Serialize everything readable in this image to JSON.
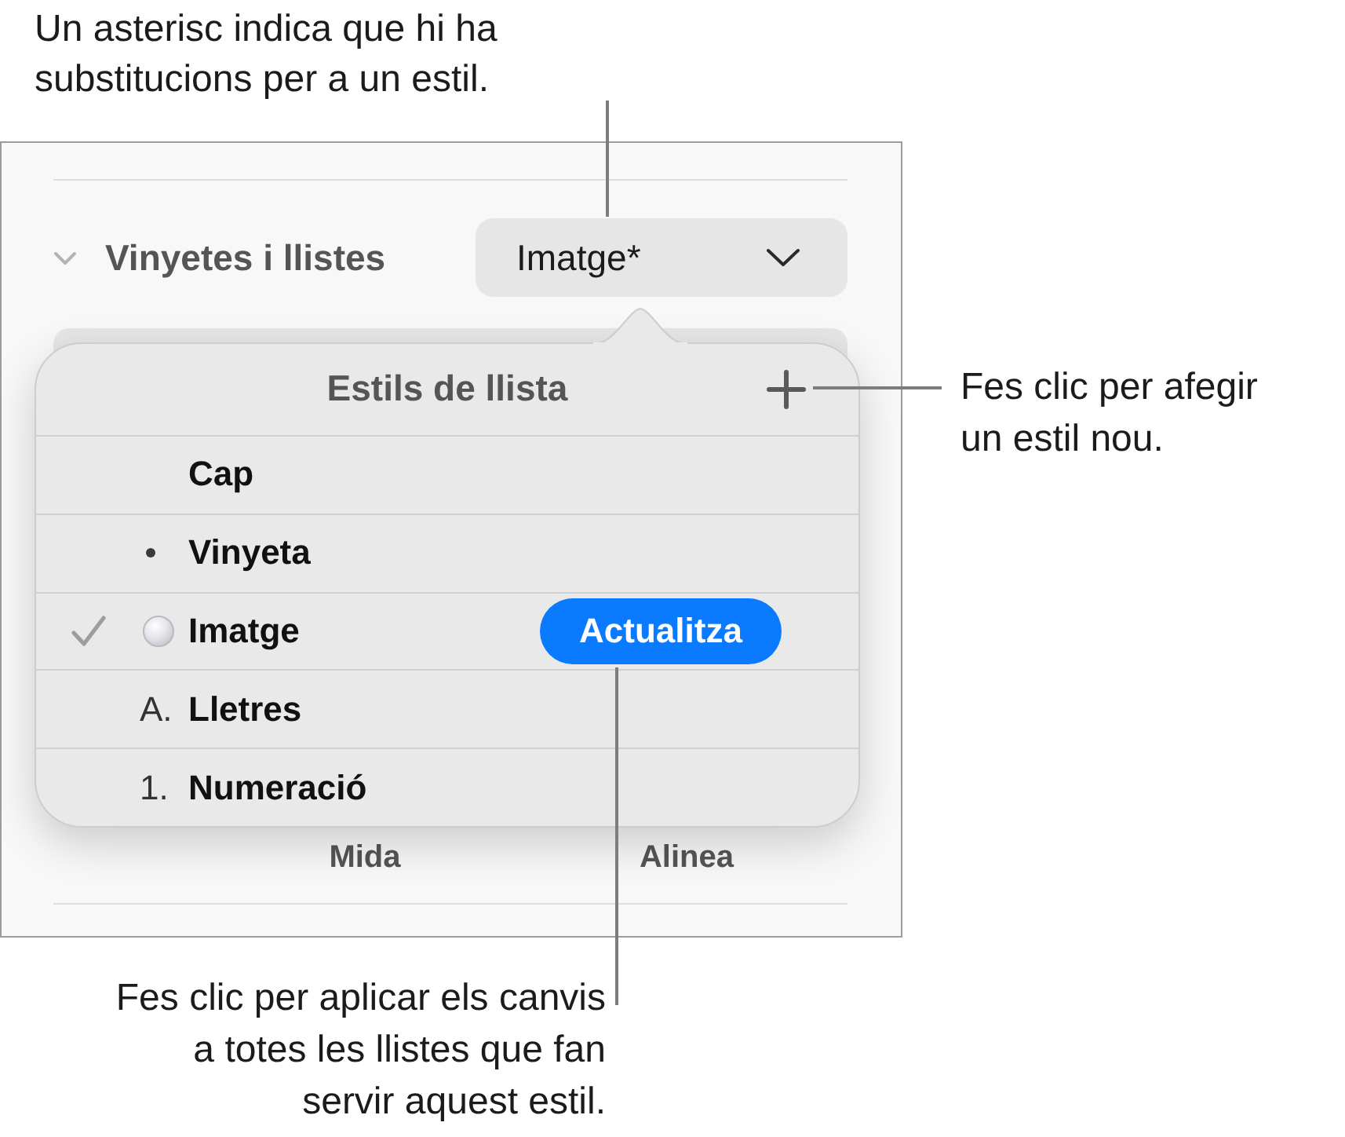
{
  "callouts": [
    {
      "lines": [
        "Un asterisc indica que hi ha",
        "substitucions per a un estil."
      ]
    },
    {
      "lines": [
        "Fes clic per afegir",
        "un estil nou."
      ]
    },
    {
      "lines": [
        "Fes clic per aplicar els canvis",
        "a totes les llistes que fan",
        "servir aquest estil."
      ]
    }
  ],
  "panel": {
    "section": {
      "title": "Vinyetes i llistes",
      "expanded": true
    },
    "style_menu": {
      "value": "Imatge*"
    },
    "labels": [
      "Mida",
      "Alinea"
    ]
  },
  "popover": {
    "title": "Estils de llista",
    "styles": [
      {
        "label": "Cap",
        "kind": "none",
        "selected": false
      },
      {
        "label": "Vinyeta",
        "kind": "bullet",
        "selected": false
      },
      {
        "label": "Imatge",
        "kind": "image",
        "selected": true,
        "action": "Actualitza"
      },
      {
        "label": "Lletres",
        "kind": "text",
        "marker": "A.",
        "selected": false
      },
      {
        "label": "Numeració",
        "kind": "text",
        "marker": "1.",
        "selected": false
      }
    ]
  }
}
